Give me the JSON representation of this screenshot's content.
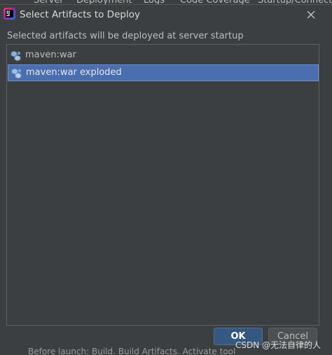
{
  "background": {
    "tabs": [
      "Server",
      "Deployment",
      "Logs",
      "Code Coverage",
      "Startup/Connection"
    ],
    "bottom_text": "Before launch: Build, Build Artifacts, Activate tool window"
  },
  "dialog": {
    "title": "Select Artifacts to Deploy",
    "prompt": "Selected artifacts will be deployed at server startup",
    "artifacts": [
      {
        "label": "maven:war",
        "icon": "artifact-war-icon",
        "selected": false
      },
      {
        "label": "maven:war exploded",
        "icon": "artifact-war-exploded-icon",
        "selected": true
      }
    ],
    "ok_label": "OK",
    "cancel_label": "Cancel"
  },
  "watermark": "CSDN @无法自律的人",
  "colors": {
    "dialog_bg": "#3c3f41",
    "selection": "#4b6eaf",
    "ok_button": "#365880",
    "text": "#bbbbbb"
  }
}
